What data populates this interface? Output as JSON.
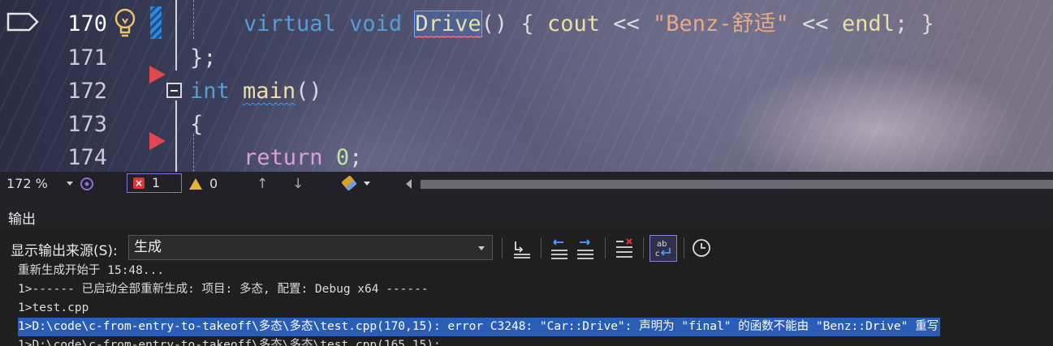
{
  "editor": {
    "lines": [
      {
        "number": "170",
        "text": [
          "virtual",
          " ",
          "void",
          " ",
          "Drive",
          "()",
          " { ",
          "cout",
          " << ",
          "\"Benz-舒适\"",
          " << ",
          "endl",
          "; }"
        ]
      },
      {
        "number": "171",
        "text": [
          "};"
        ]
      },
      {
        "number": "172",
        "text": [
          "int",
          " ",
          "main",
          "()"
        ]
      },
      {
        "number": "173",
        "text": [
          "{"
        ]
      },
      {
        "number": "174",
        "text": [
          "return",
          " ",
          "0",
          ";"
        ]
      }
    ]
  },
  "status_bar": {
    "zoom": "172 %",
    "error_count": "1",
    "warning_count": "0",
    "nav_up": "↑",
    "nav_down": "↓"
  },
  "output_panel": {
    "title": "输出",
    "source_label": "显示输出来源(S):",
    "source_value": "生成",
    "lines": [
      "重新生成开始于 15:48...",
      "1>------ 已启动全部重新生成: 项目: 多态, 配置: Debug x64 ------",
      "1>test.cpp",
      "1>D:\\code\\c-from-entry-to-takeoff\\多态\\多态\\test.cpp(170,15): error C3248: \"Car::Drive\": 声明为 \"final\" 的函数不能由 \"Benz::Drive\" 重写",
      "1>D:\\code\\c-from-entry-to-takeoff\\多态\\多态\\test.cpp(165,15):"
    ]
  }
}
